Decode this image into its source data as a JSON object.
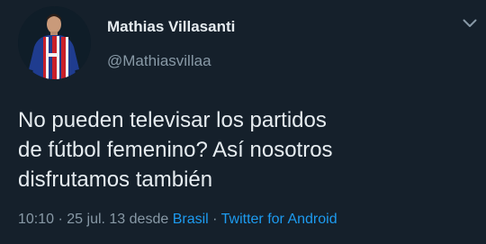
{
  "author": {
    "name": "Mathias Villasanti",
    "handle": "@Mathiasvillaa"
  },
  "tweet": {
    "lines": [
      "No pueden televisar los partidos",
      "de fútbol femenino? Así nosotros",
      "disfrutamos también"
    ]
  },
  "meta": {
    "time": "10:10",
    "sep1": " · ",
    "date": "25 jul. 13",
    "from": " desde ",
    "location": "Brasil",
    "sep2": " · ",
    "source": "Twitter for Android"
  },
  "colors": {
    "background": "#15202b",
    "text": "#e6ecf0",
    "secondary": "#8899a6",
    "link": "#1d9bf0"
  },
  "icons": {
    "more": "chevron-down-icon"
  }
}
